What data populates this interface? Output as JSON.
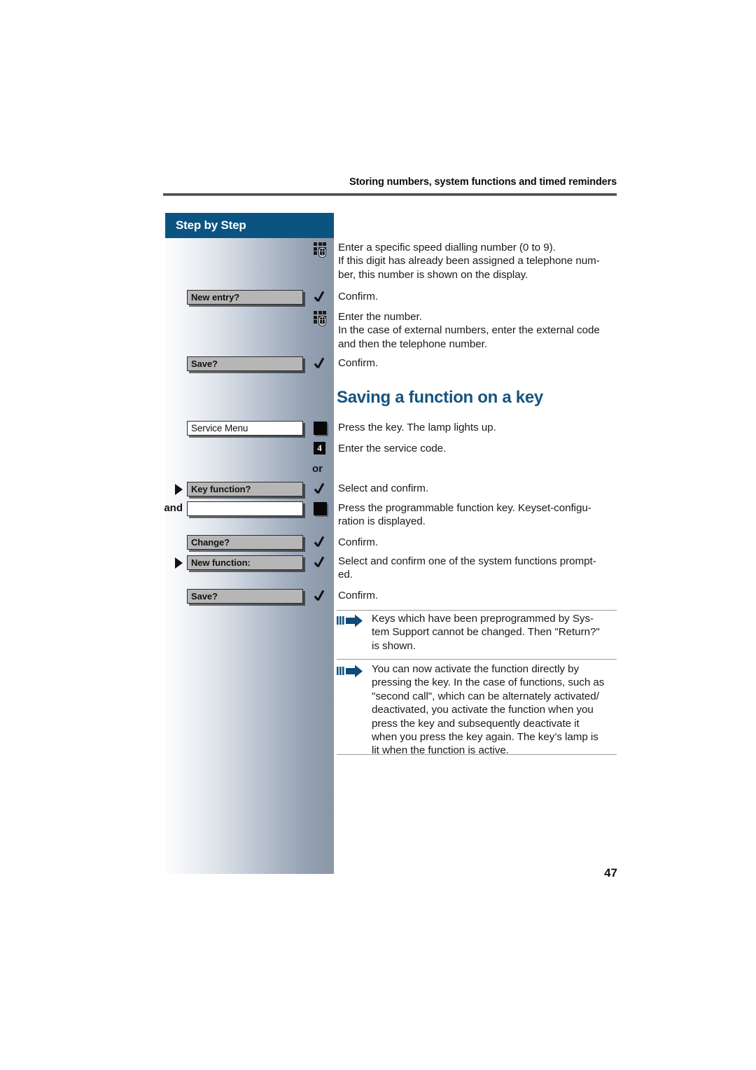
{
  "header": {
    "running_title": "Storing numbers, system functions and timed reminders"
  },
  "sidebar": {
    "title": "Step by Step",
    "and_label": "and",
    "or_label": "or"
  },
  "section": {
    "title": "Saving a function on a key"
  },
  "page": {
    "number": "47"
  },
  "steps": [
    {
      "key": "keypad-1",
      "icon": "keypad-icon",
      "softkey": null,
      "text": "Enter a specific speed dialling number (0 to 9).\nIf this digit has already been assigned a telephone num-\nber, this number is shown on the display."
    },
    {
      "key": "new-entry",
      "icon": "check-icon",
      "softkey": "New entry?",
      "text": "Confirm."
    },
    {
      "key": "keypad-2",
      "icon": "keypad-icon",
      "softkey": null,
      "text": "Enter the number.\nIn the case of external numbers, enter the external code\nand then the telephone number."
    },
    {
      "key": "save-1",
      "icon": "check-icon",
      "softkey": "Save?",
      "text": "Confirm."
    },
    {
      "key": "service-menu",
      "icon": "key-icon",
      "softkey": "Service Menu",
      "text": "Press the key. The lamp lights up."
    },
    {
      "key": "service-code",
      "icon": "digit-icon",
      "digit": "4",
      "softkey": null,
      "text": "Enter the service code."
    },
    {
      "key": "key-function",
      "icon": "check-icon",
      "softkey": "Key function?",
      "text": "Select and confirm."
    },
    {
      "key": "programmable-key",
      "icon": "key-icon",
      "softkey": "",
      "text": "Press the programmable function key. Keyset-configu-\nration is displayed."
    },
    {
      "key": "change",
      "icon": "check-icon",
      "softkey": "Change?",
      "text": "Confirm."
    },
    {
      "key": "new-function",
      "icon": "check-icon",
      "softkey": "New function:",
      "text": "Select and confirm one of the system functions prompt-\ned."
    },
    {
      "key": "save-2",
      "icon": "check-icon",
      "softkey": "Save?",
      "text": "Confirm."
    }
  ],
  "notes": [
    {
      "icon": "note-arrow-icon",
      "text": "Keys which have been preprogrammed by Sys-\ntem Support cannot be changed. Then \"Return?\"\nis shown."
    },
    {
      "icon": "note-arrow-icon",
      "text": "You can now activate the function directly by\npressing the key. In the case of functions, such as\n\"second call\", which can be alternately activated/\ndeactivated, you activate the function when you\npress the key and subsequently deactivate it\nwhen you press the key again. The key’s lamp is\nlit when the function is active."
    }
  ],
  "colors": {
    "brand_blue": "#0b5381",
    "heading_blue": "#17547f",
    "softkey_gray": "#b6b6b6",
    "sidebar_gradient_start": "#fbfcfd",
    "sidebar_gradient_end": "#8a97a8"
  }
}
